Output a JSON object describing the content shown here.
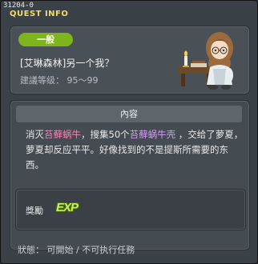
{
  "window": {
    "id_label": "31204-0",
    "title": "QUEST INFO"
  },
  "quest": {
    "badge": "一般",
    "name": "[艾琳森林]另一个我？",
    "required_level": "建議等级： 95～99"
  },
  "content": {
    "header": "內容",
    "desc_1": "消灭",
    "desc_2": "苔蘚蜗牛",
    "desc_3": "，搜集50个",
    "desc_4": "苔蘚蜗牛壳",
    "desc_5": " ，交给了萝夏，萝夏却反应平平。好像找到的不是提斯所需要的东西。"
  },
  "reward": {
    "label": "獎勵",
    "exp_icon_text": "EXP"
  },
  "status": "狀態： 可開始 / 不可执行任務",
  "colors": {
    "accent_green": "#7fb51c",
    "highlight_pink": "#ff7fb6",
    "highlight_purple": "#d899ff",
    "title_yellow": "#f2dc6a"
  }
}
